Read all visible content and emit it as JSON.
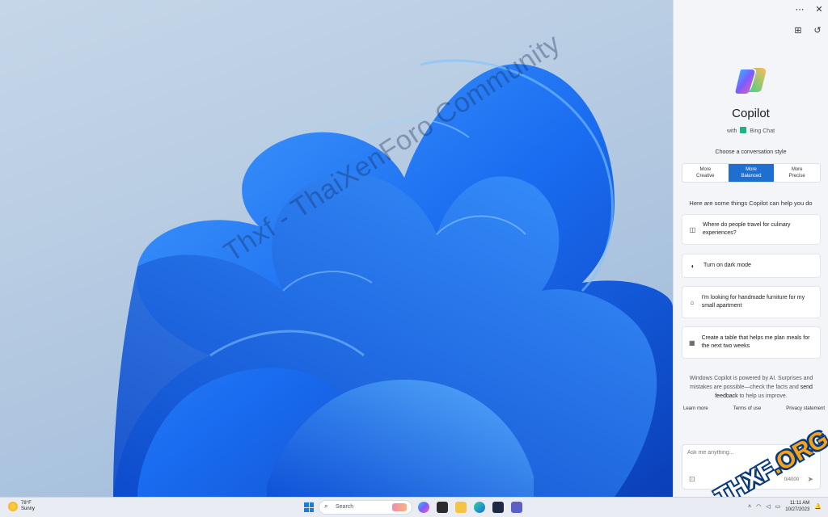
{
  "watermark_text": "Thxf - ThaiXenForo Community",
  "copilot": {
    "title": "Copilot",
    "subtitle_prefix": "with",
    "subtitle_service": "Bing Chat",
    "menu_icon": "ellipsis-icon",
    "close_icon": "close-icon",
    "style_label": "Choose a conversation style",
    "styles": [
      {
        "line1": "More",
        "line2": "Creative",
        "active": false
      },
      {
        "line1": "More",
        "line2": "Balanced",
        "active": true
      },
      {
        "line1": "More",
        "line2": "Precise",
        "active": false
      }
    ],
    "help_label": "Here are some things Copilot can help you do",
    "prompts": [
      {
        "icon": "briefcase-icon",
        "text": "Where do people travel for culinary experiences?"
      },
      {
        "icon": "palette-icon",
        "text": "Turn on dark mode"
      },
      {
        "icon": "tag-icon",
        "text": "I'm looking for handmade furniture for my small apartment"
      },
      {
        "icon": "table-icon",
        "text": "Create a table that helps me plan meals for the next two weeks"
      }
    ],
    "disclaimer_pre": "Windows Copilot is powered by AI. Surprises and mistakes are possible—check the facts and ",
    "disclaimer_link": "send feedback",
    "disclaimer_post": " to help us improve.",
    "links": [
      "Learn more",
      "Terms of use",
      "Privacy statement"
    ],
    "input_placeholder": "Ask me anything...",
    "char_count": "0/4000",
    "accent_color": "#1f6fd1"
  },
  "taskbar": {
    "weather_temp": "78°F",
    "weather_desc": "Sunny",
    "search_placeholder": "Search",
    "time": "11:11 AM",
    "date": "10/27/2023"
  },
  "overlay_logo": {
    "prefix": "THXF",
    "suffix": ".ORG"
  }
}
